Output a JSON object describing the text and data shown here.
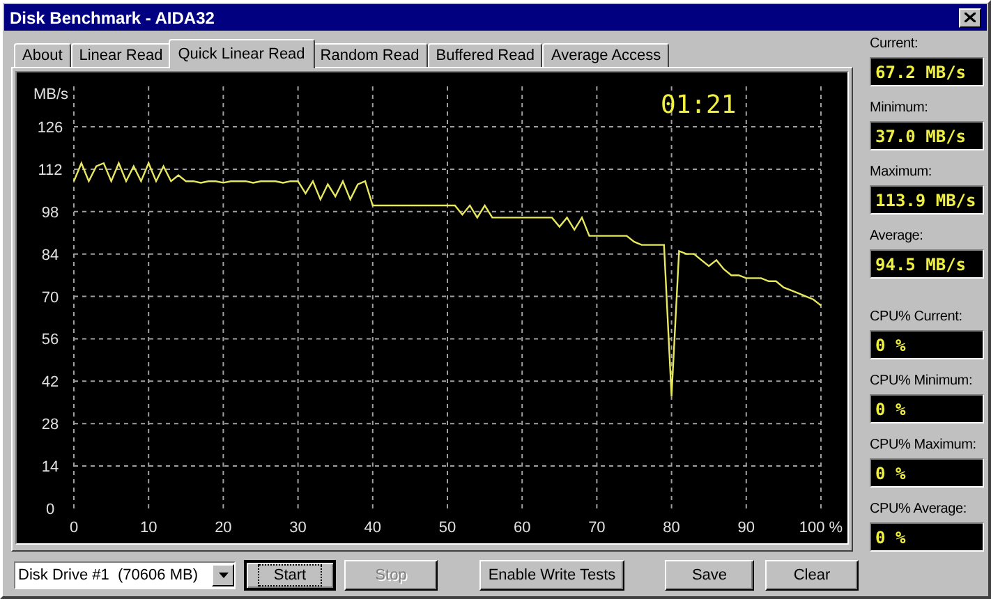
{
  "window": {
    "title": "Disk Benchmark - AIDA32"
  },
  "tabs": [
    {
      "label": "About",
      "selected": false
    },
    {
      "label": "Linear Read",
      "selected": false
    },
    {
      "label": "Quick Linear Read",
      "selected": true
    },
    {
      "label": "Random Read",
      "selected": false
    },
    {
      "label": "Buffered Read",
      "selected": false
    },
    {
      "label": "Average Access",
      "selected": false
    }
  ],
  "chart": {
    "timer": "01:21",
    "chart_data": {
      "type": "line",
      "grid": true,
      "ylabel": "MB/s",
      "xlim": [
        0,
        100
      ],
      "ylim": [
        0,
        126
      ],
      "xticks": [
        0,
        10,
        20,
        30,
        40,
        50,
        60,
        70,
        80,
        90,
        {
          "value": 100,
          "label": "100 %"
        }
      ],
      "yticks": [
        0,
        14,
        28,
        42,
        56,
        70,
        84,
        98,
        112,
        126
      ],
      "x": [
        0,
        1,
        2,
        3,
        4,
        5,
        6,
        7,
        8,
        9,
        10,
        11,
        12,
        13,
        14,
        15,
        16,
        17,
        18,
        19,
        20,
        21,
        22,
        23,
        24,
        25,
        26,
        27,
        28,
        29,
        30,
        31,
        32,
        33,
        34,
        35,
        36,
        37,
        38,
        39,
        40,
        41,
        42,
        43,
        44,
        45,
        46,
        47,
        48,
        49,
        50,
        51,
        52,
        53,
        54,
        55,
        56,
        57,
        58,
        59,
        60,
        61,
        62,
        63,
        64,
        65,
        66,
        67,
        68,
        69,
        70,
        71,
        72,
        73,
        74,
        75,
        76,
        77,
        78,
        79,
        80,
        81,
        82,
        83,
        84,
        85,
        86,
        87,
        88,
        89,
        90,
        91,
        92,
        93,
        94,
        95,
        96,
        97,
        98,
        99,
        100
      ],
      "series": [
        {
          "color": "#e8e860",
          "values": [
            108,
            114,
            108,
            113,
            114,
            108,
            114,
            108,
            113,
            108,
            114,
            108,
            113,
            108,
            110,
            108,
            108,
            107.5,
            108,
            108,
            107.5,
            108,
            108,
            108,
            107.5,
            108,
            108,
            108,
            107.5,
            108,
            108,
            104,
            108,
            102,
            107,
            103,
            108,
            102,
            107,
            108,
            100,
            100,
            100,
            100,
            100,
            100,
            100,
            100,
            100,
            100,
            100,
            100,
            97,
            100,
            96,
            100,
            96,
            96,
            96,
            96,
            96,
            96,
            96,
            96,
            96,
            93,
            96,
            92,
            96,
            90,
            90,
            90,
            90,
            90,
            90,
            88,
            87,
            87,
            87,
            87,
            37,
            85,
            84,
            84,
            82,
            80,
            82,
            79,
            77,
            77,
            76,
            76,
            76,
            75,
            75,
            73,
            72,
            71,
            70,
            69,
            67
          ]
        }
      ]
    }
  },
  "stats": [
    {
      "label": "Current:",
      "value": "67.2 MB/s"
    },
    {
      "label": "Minimum:",
      "value": "37.0 MB/s"
    },
    {
      "label": "Maximum:",
      "value": "113.9 MB/s"
    },
    {
      "label": "Average:",
      "value": "94.5 MB/s"
    }
  ],
  "cpu_stats": [
    {
      "label": "CPU% Current:",
      "value": "0 %"
    },
    {
      "label": "CPU% Minimum:",
      "value": "0 %"
    },
    {
      "label": "CPU% Maximum:",
      "value": "0 %"
    },
    {
      "label": "CPU% Average:",
      "value": "0 %"
    }
  ],
  "drive_select": {
    "value": "Disk Drive #1  (70606 MB)"
  },
  "buttons": [
    {
      "label": "Start",
      "focused": true,
      "disabled": false
    },
    {
      "label": "Stop",
      "focused": false,
      "disabled": true
    },
    {
      "label": "Enable Write Tests",
      "focused": false,
      "disabled": false
    },
    {
      "label": "Save",
      "focused": false,
      "disabled": false
    },
    {
      "label": "Clear",
      "focused": false,
      "disabled": false
    }
  ]
}
